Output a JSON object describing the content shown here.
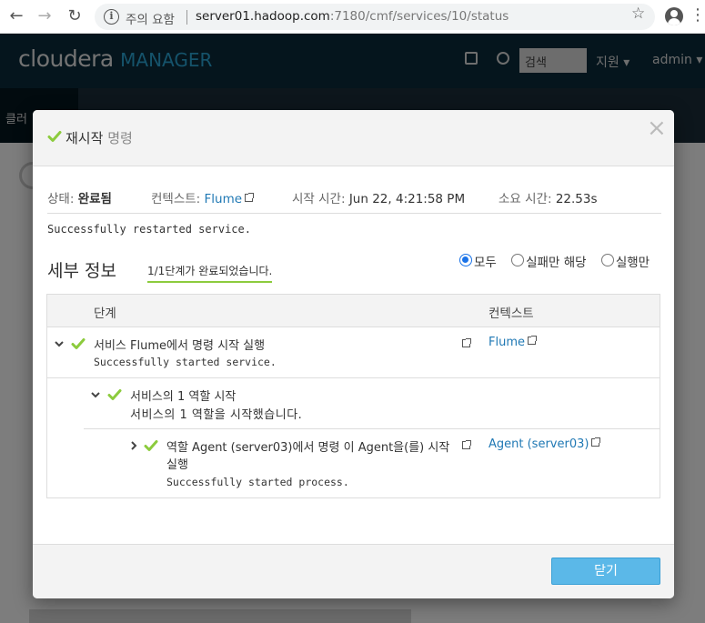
{
  "browser": {
    "security_label": "주의 요함",
    "url_host": "server01.hadoop.com",
    "url_path": ":7180/cmf/services/10/status"
  },
  "app_header": {
    "logo_main": "cloudera",
    "logo_sub": "MANAGER",
    "search_placeholder": "검색",
    "support_label": "지원 ▾",
    "admin_label": "admin ▾",
    "subnav_label": "클러"
  },
  "modal": {
    "title_main": "재시작",
    "title_sub": "명령",
    "status": {
      "state_label": "상태:",
      "state_value": "완료됨",
      "context_label": "컨텍스트:",
      "context_value": "Flume",
      "start_label": "시작 시간:",
      "start_value": "Jun 22, 4:21:58 PM",
      "duration_label": "소요 시간:",
      "duration_value": "22.53s"
    },
    "result_message": "Successfully restarted service.",
    "details_title": "세부 정보",
    "steps_done": "1/1단계가 완료되었습니다.",
    "filters": [
      {
        "label": "모두",
        "checked": true
      },
      {
        "label": "실패만 해당",
        "checked": false
      },
      {
        "label": "실행만",
        "checked": false
      }
    ],
    "table": {
      "col_step": "단계",
      "col_context": "컨텍스트",
      "rows": [
        {
          "title": "서비스 Flume에서 명령 시작 실행",
          "message": "Successfully started service.",
          "context": "Flume"
        },
        {
          "title": "서비스의 1 역할 시작",
          "message": "서비스의 1 역할을 시작했습니다."
        },
        {
          "title_line1": "역할 Agent (server03)에서 명령 이 Agent을(를) 시작",
          "title_line2": "실행",
          "message": "Successfully started process.",
          "context": "Agent (server03)"
        }
      ]
    },
    "close_button": "닫기"
  },
  "colors": {
    "check_green": "#8ccb3d",
    "link_blue": "#1f78b4",
    "primary_button": "#5bb8e8",
    "header_navy": "#0b2a3b"
  }
}
